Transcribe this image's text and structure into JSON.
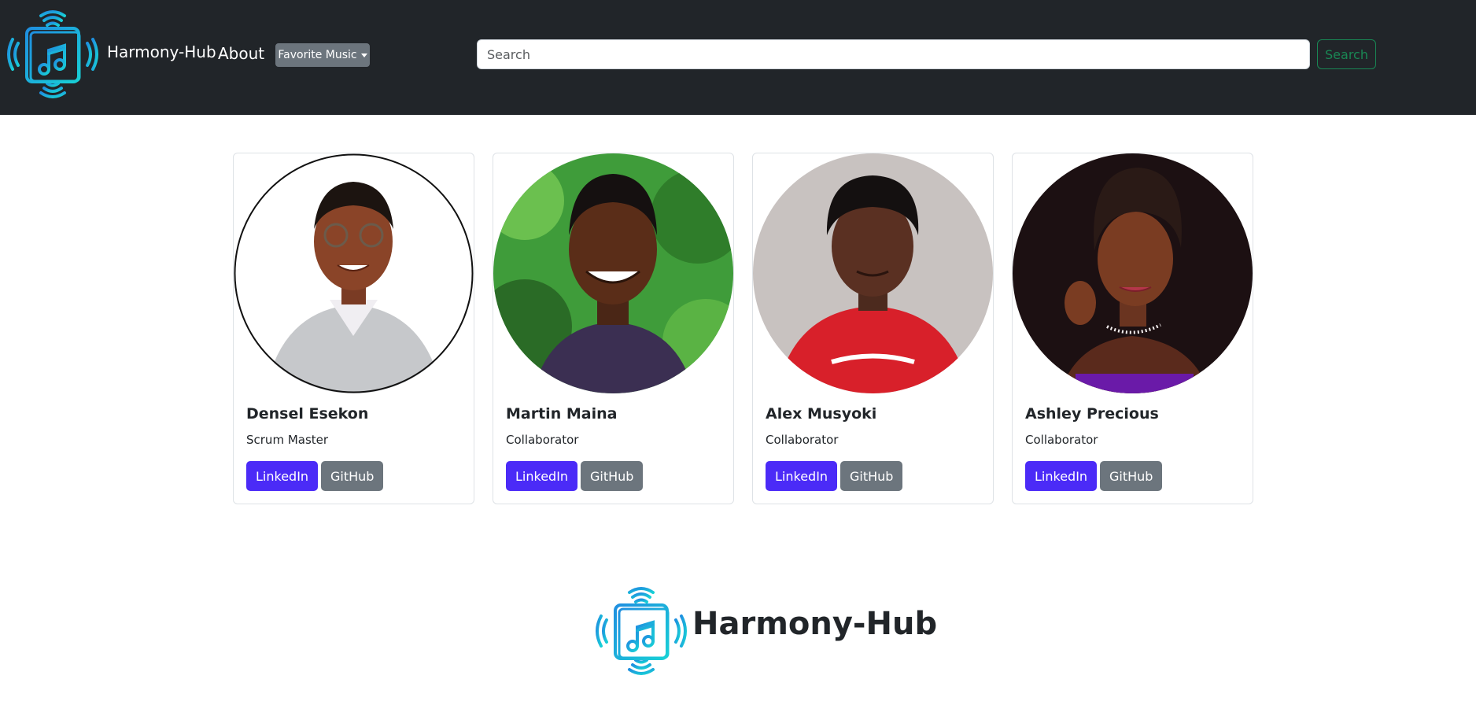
{
  "navbar": {
    "brand": "Harmony-Hub",
    "about_label": "About",
    "dropdown_label": "Favorite Music",
    "search_placeholder": "Search",
    "search_button": "Search",
    "logo_icon": "music-device-waves-icon"
  },
  "team": [
    {
      "name": "Densel Esekon",
      "role": "Scrum Master",
      "linkedin_label": "LinkedIn",
      "github_label": "GitHub"
    },
    {
      "name": "Martin Maina",
      "role": "Collaborator",
      "linkedin_label": "LinkedIn",
      "github_label": "GitHub"
    },
    {
      "name": "Alex Musyoki",
      "role": "Collaborator",
      "linkedin_label": "LinkedIn",
      "github_label": "GitHub"
    },
    {
      "name": "Ashley Precious",
      "role": "Collaborator",
      "linkedin_label": "LinkedIn",
      "github_label": "GitHub"
    }
  ],
  "footer": {
    "brand": "Harmony-Hub"
  },
  "colors": {
    "navbar_bg": "#212529",
    "linkedin_button": "#4b2bf7",
    "github_button": "#6c757d",
    "search_button": "#198754",
    "logo_gradient_start": "#29a3e0",
    "logo_gradient_end": "#14d0d8"
  }
}
